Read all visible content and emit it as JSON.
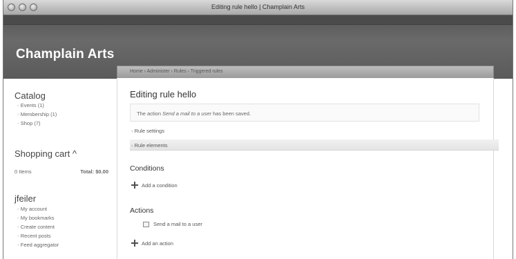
{
  "window": {
    "title": "Editing rule hello | Champlain Arts"
  },
  "site": {
    "name": "Champlain Arts"
  },
  "breadcrumb": "Home › Administer › Rules › Triggered rules",
  "sidebar": {
    "catalog": {
      "title": "Catalog",
      "items": [
        "Events (1)",
        "Membership (1)",
        "Shop (7)"
      ]
    },
    "cart": {
      "title": "Shopping cart ^",
      "items_label": "0 Items",
      "total_label": "Total: $0.00"
    },
    "user": {
      "title": "jfeiler",
      "items": [
        "My account",
        "My bookmarks",
        "Create content",
        "Recent posts",
        "Feed aggregator"
      ]
    }
  },
  "main": {
    "page_title": "Editing rule hello",
    "status": {
      "prefix": "The action ",
      "action_name": "Send a mail to a user",
      "suffix": " has been saved."
    },
    "rule_settings_label": "Rule settings",
    "rule_elements_label": "Rule elements",
    "conditions": {
      "title": "Conditions",
      "add_label": "Add a condition"
    },
    "actions": {
      "title": "Actions",
      "item_label": "Send a mail to a user",
      "add_label": "Add an action"
    }
  }
}
